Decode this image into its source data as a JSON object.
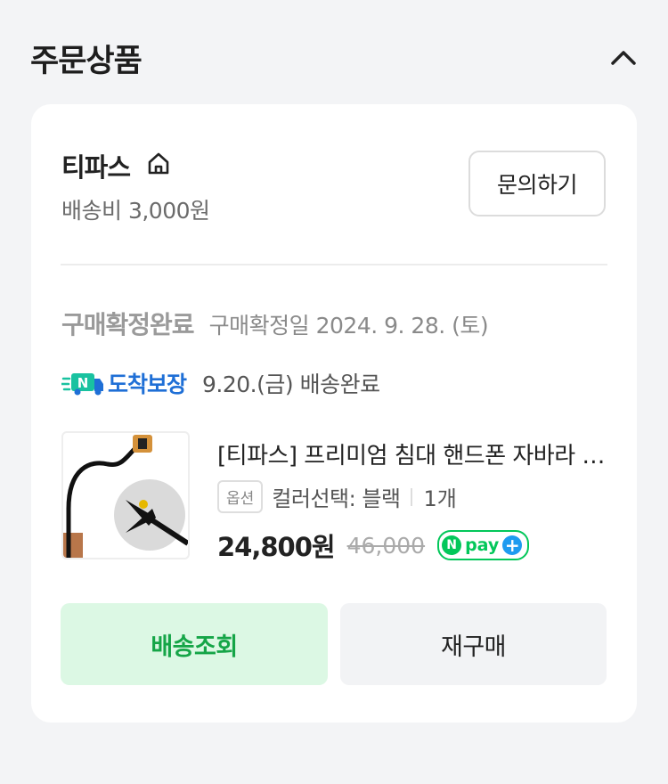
{
  "header": {
    "title": "주문상품"
  },
  "seller": {
    "name": "티파스",
    "shipping_fee": "배송비 3,000원",
    "inquiry_label": "문의하기"
  },
  "order": {
    "status": "구매확정완료",
    "confirm_date": "구매확정일 2024. 9. 28. (토)",
    "badge_text": "도착보장",
    "delivery_status": "9.20.(금) 배송완료"
  },
  "product": {
    "name": "[티파스] 프리미엄 침대 핸드폰 자바라 거치대",
    "option_tag": "옵션",
    "option_text": "컬러선택: 블랙",
    "quantity": "1개",
    "price": "24,800원",
    "original_price": "46,000",
    "pay_badge": "pay"
  },
  "actions": {
    "track_label": "배송조회",
    "rebuy_label": "재구매"
  },
  "colors": {
    "accent_green": "#15a547",
    "track_bg": "#dcf8e4",
    "badge_blue": "#1f6fd6",
    "npay_green": "#03c75a"
  }
}
